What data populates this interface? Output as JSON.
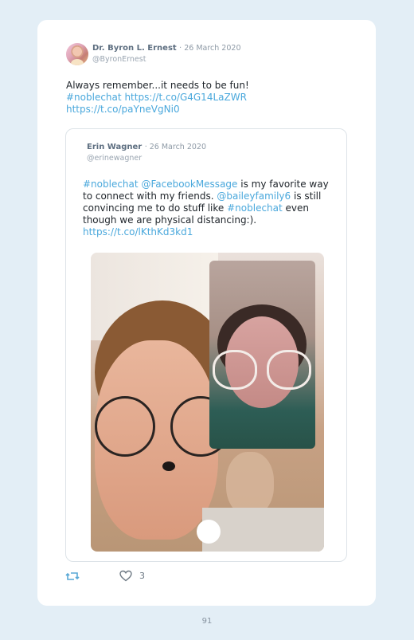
{
  "tweet": {
    "author_name": "Dr. Byron L. Ernest",
    "date": "26 March 2020",
    "handle": "@ByronErnest",
    "text_line1": "Always remember...it needs to be fun!",
    "hashtag1": "#noblechat",
    "link1": "https://t.co/G4G14LaZWR",
    "link2": "https://t.co/paYneVgNi0"
  },
  "quoted": {
    "author_name": "Erin Wagner",
    "date": "26 March 2020",
    "handle": "@erinewagner",
    "hashtag": "#noblechat",
    "mention1": "@FacebookMessage",
    "text_a": " is my favorite way",
    "text_b": "to connect with my friends. ",
    "mention2": "@baileyfamily6",
    "text_c": " is still",
    "text_d": "convincing me to do stuff like ",
    "hashtag2": "#noblechat",
    "text_e": " even",
    "text_f": "though we are physical distancing:).",
    "link": "https://t.co/lKthKd3kd1"
  },
  "actions": {
    "retweet_icon": "retweet-icon",
    "like_icon": "heart-icon",
    "like_count": "3"
  },
  "page": {
    "number": "91"
  },
  "colors": {
    "link": "#4aa8dc",
    "background": "#e3eef6",
    "card": "#ffffff"
  }
}
